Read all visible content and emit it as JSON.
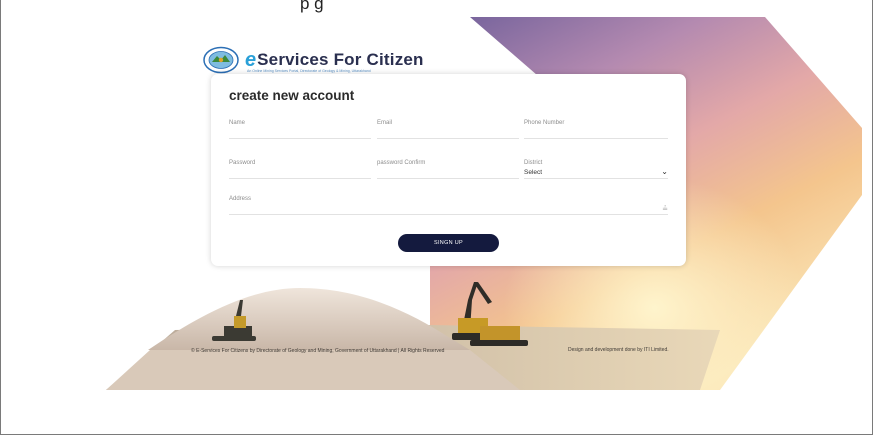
{
  "brand": {
    "title_prefix": "e",
    "title": "Services For Citizen",
    "subtitle": "An Online Mining Services Portal, Directorate of Geology & Mining, Uttarakhand"
  },
  "form": {
    "title": "create new account",
    "fields": {
      "name": "Name",
      "email": "Email",
      "phone": "Phone Number",
      "password": "Password",
      "password_confirm": "password Confirm",
      "district": "District",
      "district_value": "Select",
      "address": "Address"
    },
    "submit_label": "SINGN UP"
  },
  "footer": {
    "copyright": "© E-Services For Citizens by Directorate of Geology and Mining, Government of Uttarakhand | All Rights Reserved",
    "credit": "Design and development done by ITI Limited."
  },
  "colors": {
    "button": "#141a3e",
    "brand_text": "#2a2f4f",
    "brand_accent": "#2aa0d8"
  },
  "icons": [
    "emblem-logo",
    "chevron-down-icon",
    "resize-handle-icon"
  ]
}
